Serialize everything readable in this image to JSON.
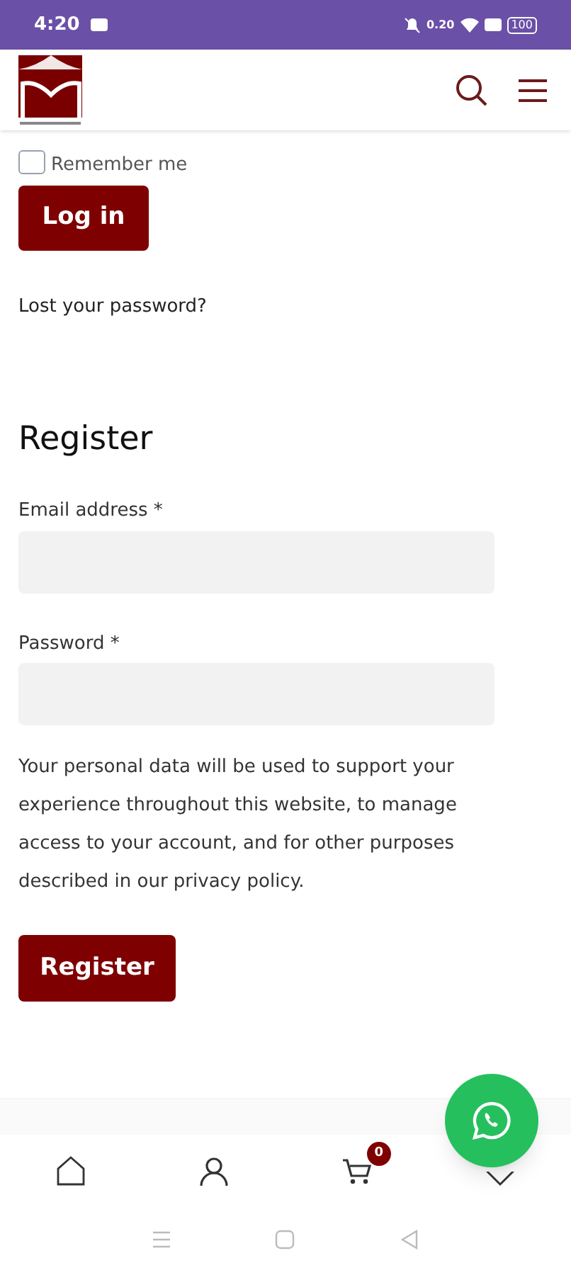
{
  "status_bar": {
    "time": "4:20",
    "net_speed": "0.20",
    "battery": "100"
  },
  "login": {
    "remember_me": {
      "label": "Remember me",
      "checked": false
    },
    "button": "Log in",
    "lost_password": "Lost your password?"
  },
  "register": {
    "title": "Register",
    "fields": [
      {
        "label": "Email address *"
      },
      {
        "label": "Password *"
      }
    ],
    "privacy_text": "Your personal data will be used to support your experience throughout this website, to manage access to your account, and for other purposes described in our privacy policy.",
    "button": "Register"
  },
  "bottom_nav": [
    {
      "kind": "home",
      "selected": false
    },
    {
      "kind": "account",
      "selected": false
    },
    {
      "kind": "cart",
      "badge": "0",
      "selected": false
    },
    {
      "kind": "wishlist",
      "selected": false
    }
  ]
}
